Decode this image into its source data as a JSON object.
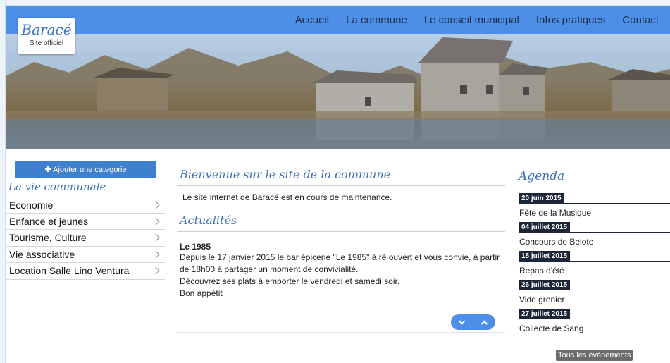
{
  "nav": {
    "items": [
      "Accueil",
      "La commune",
      "Le conseil municipal",
      "Infos pratiques",
      "Contact"
    ]
  },
  "logo": {
    "name": "Baracé",
    "subtitle": "Site officiel"
  },
  "sidebar": {
    "add_category": "Ajouter une categorie",
    "title": "La vie communale",
    "items": [
      "Economie",
      "Enfance et jeunes",
      "Tourisme, Culture",
      "Vie associative",
      "Location Salle Lino Ventura"
    ]
  },
  "main": {
    "welcome_title": "Bienvenue sur le site de la commune",
    "welcome_text": "Le site internet de Baracé est en cours de maintenance.",
    "news_title": "Actualités",
    "news_item": {
      "heading": "Le 1985",
      "line1": "Depuis le 17 janvier 2015 le bar épicerie \"Le 1985\" à ré ouvert et vous convie, à partir de 18h00 à partager un moment de convivialité.",
      "line2": "Découvrez ses plats à emporter le vendredi et samedi soir.",
      "line3": "Bon appétit"
    }
  },
  "agenda": {
    "title": "Agenda",
    "events": [
      {
        "date": "20 juin 2015",
        "name": "Fête de la Musique"
      },
      {
        "date": "04 juillet 2015",
        "name": "Concours de Belote"
      },
      {
        "date": "18 juillet 2015",
        "name": "Repas d'été"
      },
      {
        "date": "26 juillet 2015",
        "name": "Vide grenier"
      },
      {
        "date": "27 juillet 2015",
        "name": "Collecte de Sang"
      }
    ],
    "all_events": "Tous les évènements"
  },
  "colors": {
    "header": "#4d8ee6",
    "accent": "#3d6fb8",
    "date_badge": "#1c2638"
  }
}
